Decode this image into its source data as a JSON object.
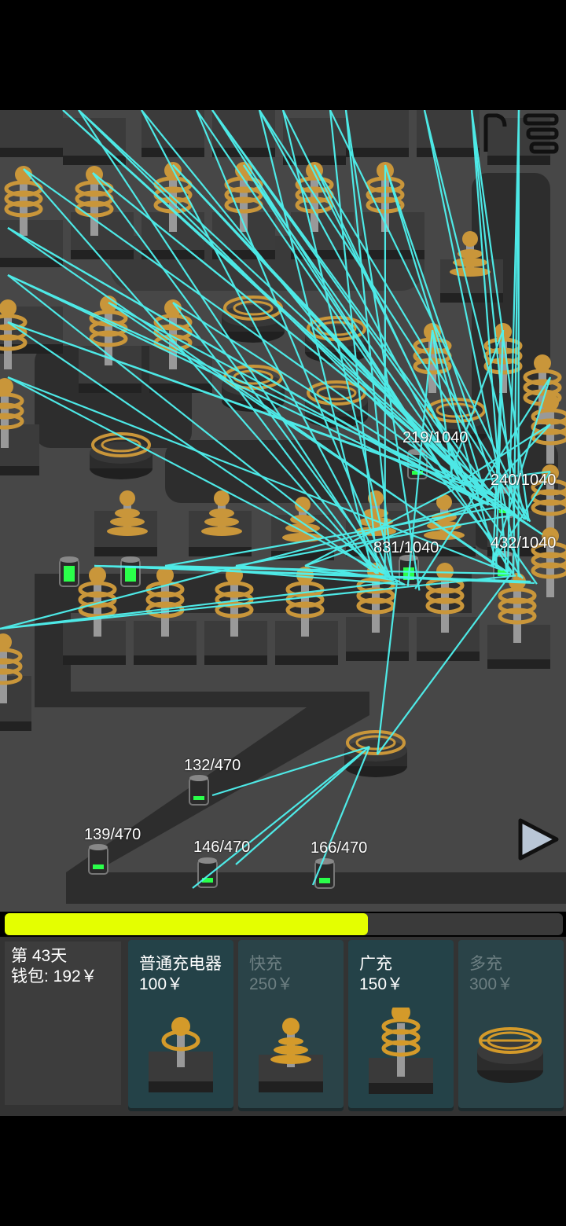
{
  "hud": {
    "day_label": "第 43天",
    "wallet_label": "钱包: 192￥",
    "progress": 0.65
  },
  "chargers_labels": [
    {
      "id": "c1",
      "text": "219/1040"
    },
    {
      "id": "c2",
      "text": "240/1040"
    },
    {
      "id": "c3",
      "text": "831/1040"
    },
    {
      "id": "c4",
      "text": "432/1040"
    },
    {
      "id": "c5",
      "text": "132/470"
    },
    {
      "id": "c6",
      "text": "139/470"
    },
    {
      "id": "c7",
      "text": "146/470"
    },
    {
      "id": "c8",
      "text": "166/470"
    }
  ],
  "shop": {
    "items": [
      {
        "name": "普通充电器",
        "price": "100￥",
        "enabled": true,
        "icon": "basic-charger-icon"
      },
      {
        "name": "快充",
        "price": "250￥",
        "enabled": false,
        "icon": "fast-charger-icon"
      },
      {
        "name": "广充",
        "price": "150￥",
        "enabled": true,
        "icon": "wide-charger-icon"
      },
      {
        "name": "多充",
        "price": "300￥",
        "enabled": false,
        "icon": "multi-charger-icon"
      }
    ]
  },
  "colors": {
    "beam": "#4ff3f0",
    "gold": "#c9963a",
    "progress": "#e4ff00",
    "battery_green": "#2aff4a"
  }
}
